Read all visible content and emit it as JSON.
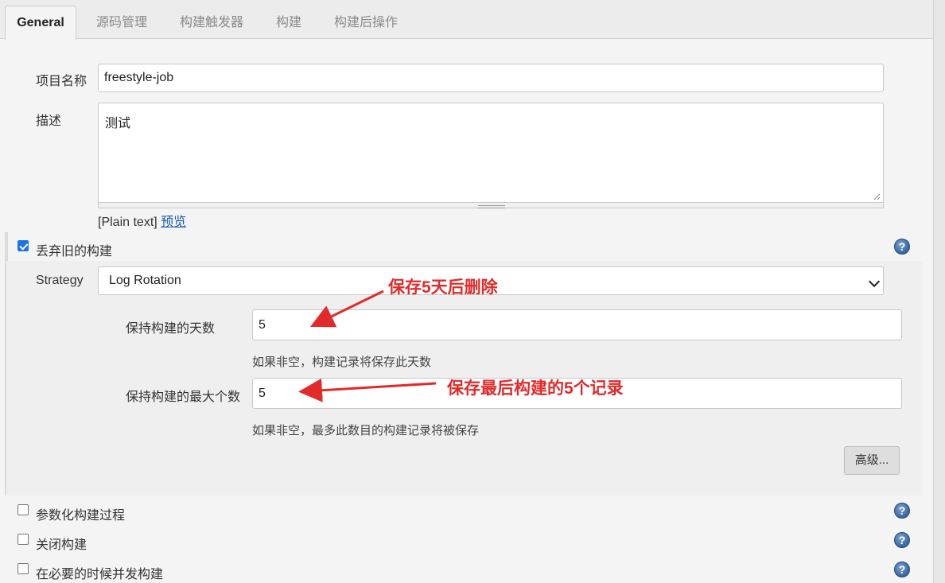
{
  "tabs": [
    "General",
    "源码管理",
    "构建触发器",
    "构建",
    "构建后操作"
  ],
  "project": {
    "label": "项目名称",
    "value": "freestyle-job"
  },
  "description": {
    "label": "描述",
    "value": "测试",
    "format_note": "[Plain text]",
    "preview_link": "预览"
  },
  "discard_old": {
    "label": "丢弃旧的构建",
    "checked": true,
    "strategy_label": "Strategy",
    "strategy_value": "Log Rotation",
    "days_label": "保持构建的天数",
    "days_value": "5",
    "days_hint": "如果非空，构建记录将保存此天数",
    "max_label": "保持构建的最大个数",
    "max_value": "5",
    "max_hint": "如果非空，最多此数目的构建记录将被保存",
    "advanced_button": "高级..."
  },
  "options": [
    {
      "label": "参数化构建过程",
      "checked": false
    },
    {
      "label": "关闭构建",
      "checked": false
    },
    {
      "label": "在必要的时候并发构建",
      "checked": false
    }
  ],
  "annotations": {
    "days_note": "保存5天后删除",
    "max_note": "保存最后构建的5个记录"
  },
  "colors": {
    "annotation": "#e12b2b",
    "accent": "#1a73e8",
    "link": "#1a5aa8"
  },
  "icons": {
    "help": "help-icon",
    "checkbox": "checkbox",
    "dropdown": "chevron-down-icon"
  }
}
